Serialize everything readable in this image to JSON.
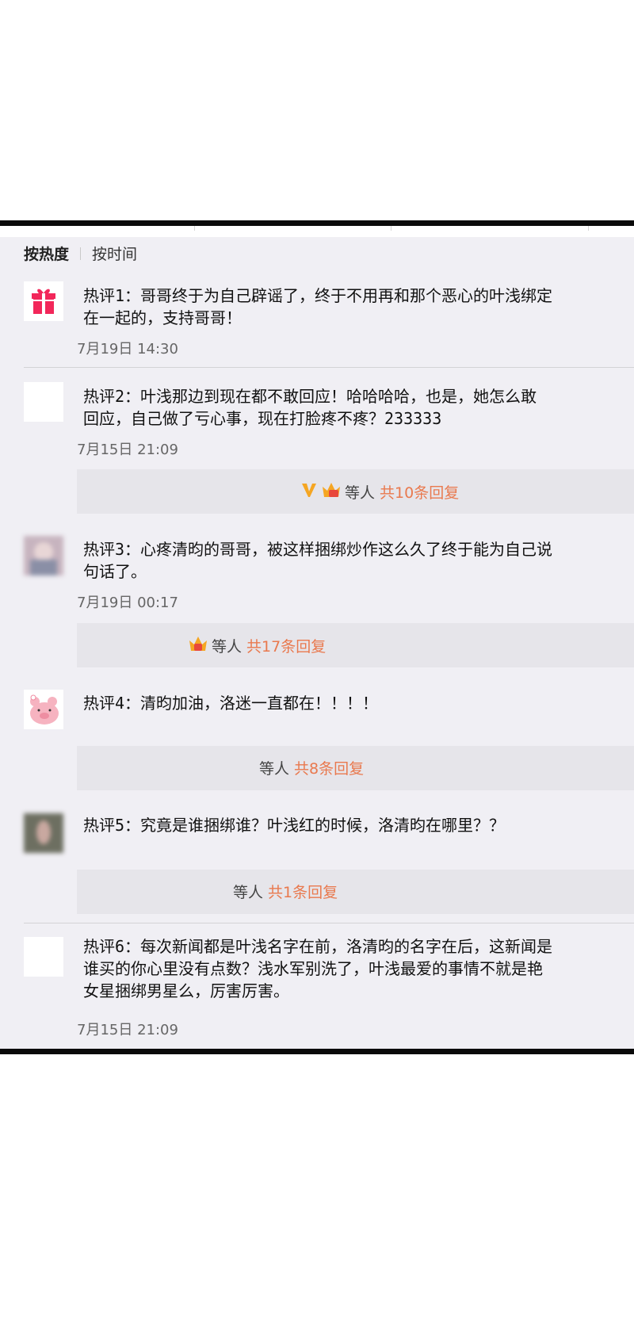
{
  "sort": {
    "active": "按热度",
    "other": "按时间"
  },
  "comments": [
    {
      "line1": "热评1：哥哥终于为自己辟谣了，终于不用再和那个恶心的叶浅绑定",
      "line2": "在一起的，支持哥哥！",
      "line3": "",
      "time": "7月19日 14:30"
    },
    {
      "line1": "热评2：叶浅那边到现在都不敢回应！哈哈哈哈，也是，她怎么敢",
      "line2": "回应，自己做了亏心事，现在打脸疼不疼？233333",
      "line3": "",
      "time": "7月15日 21:09"
    },
    {
      "line1": "热评3：心疼清昀的哥哥，被这样捆绑炒作这么久了终于能为自己说",
      "line2": "句话了。",
      "line3": "",
      "time": "7月19日 00:17"
    },
    {
      "line1": "热评4：清昀加油，洛迷一直都在！！！！",
      "line2": "",
      "line3": "",
      "time": ""
    },
    {
      "line1": "热评5：究竟是谁捆绑谁？叶浅红的时候，洛清昀在哪里？？",
      "line2": "",
      "line3": "",
      "time": ""
    },
    {
      "line1": "热评6：每次新闻都是叶浅名字在前，洛清昀的名字在后，这新闻是",
      "line2": "谁买的你心里没有点数？浅水军别洗了，叶浅最爱的事情不就是艳",
      "line3": "女星捆绑男星么，厉害厉害。",
      "time": "7月15日 21:09"
    }
  ],
  "replies": [
    {
      "label": "等人",
      "count": "共10条回复"
    },
    {
      "label": "等人",
      "count": "共17条回复"
    },
    {
      "label": "等人",
      "count": "共8条回复"
    },
    {
      "label": "等人",
      "count": "共1条回复"
    }
  ],
  "colors": {
    "accent": "#e9794e",
    "gift": "#f2275a",
    "vip": "#f5a623"
  },
  "icons": [
    "gift-icon",
    "vip-v-icon",
    "crown-badge-icon"
  ]
}
